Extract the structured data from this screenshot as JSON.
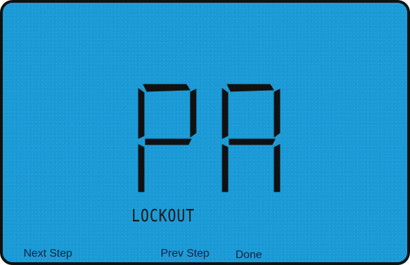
{
  "display": {
    "code": "PA",
    "status_text": "LOCKOUT",
    "background_color": "#1a9ad6",
    "segment_color": "#111111"
  },
  "softkeys": {
    "next_step": "Next Step",
    "prev_step": "Prev Step",
    "done": "Done"
  }
}
